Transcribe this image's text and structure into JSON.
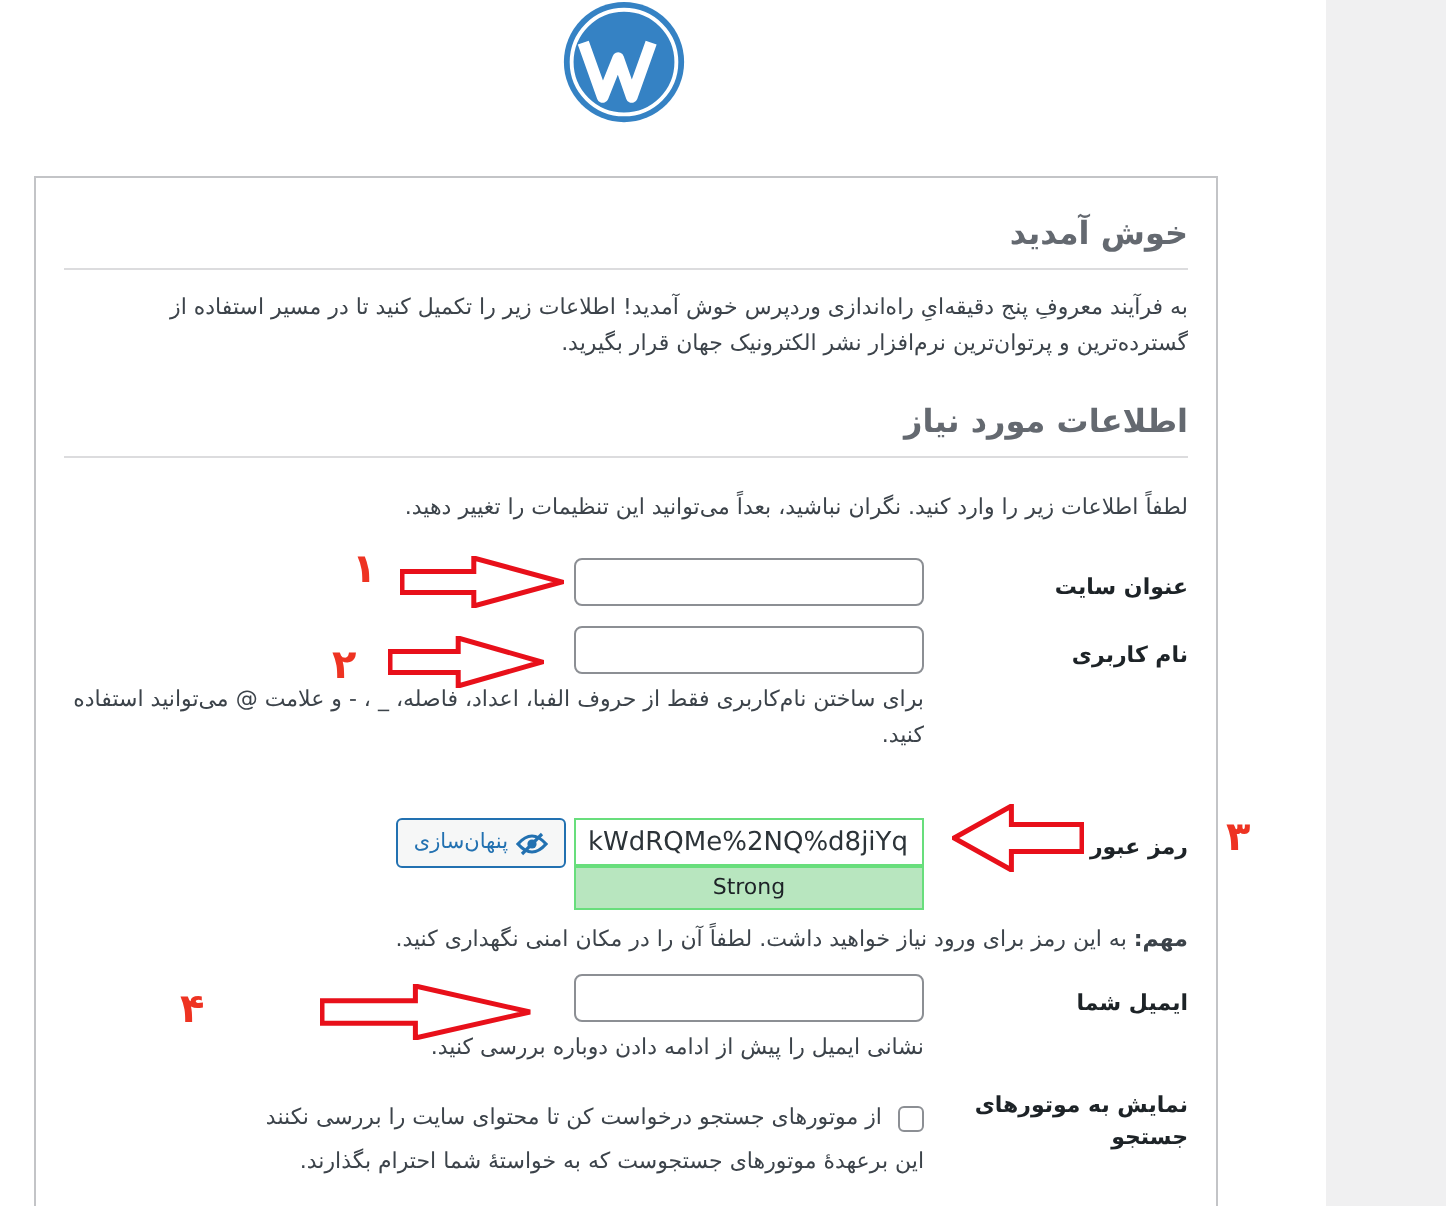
{
  "welcome": {
    "title": "خوش آمدید",
    "text": "به فرآیند معروفِ پنج دقیقه‌ایِ راه‌اندازی وردپرس خوش آمدید! اطلاعات زیر را تکمیل کنید تا در مسیر استفاده از گسترده‌ترین و پرتوان‌ترین نرم‌افزار نشر الکترونیک جهان قرار بگیرید."
  },
  "required": {
    "title": "اطلاعات مورد نیاز",
    "intro": "لطفاً اطلاعات زیر را وارد کنید. نگران نباشید، بعداً می‌توانید این تنظیمات را تغییر دهید."
  },
  "fields": [
    {
      "kind": "text",
      "label": "عنوان سایت"
    },
    {
      "kind": "text",
      "label": "نام کاربری",
      "help": "برای ساختن نام‌کاربری فقط از حروف الفبا، اعداد، فاصله، _ ، - و علامت @ می‌توانید استفاده کنید."
    },
    {
      "kind": "password",
      "label": "رمز عبور",
      "value": "kWdRQMe%2NQ%d8jiYq",
      "strength": "Strong",
      "toggle": "پنهان‌سازی",
      "help": "**مهم:** به این رمز برای ورود نیاز خواهید داشت. لطفاً آن را در مکان امنی نگهداری کنید."
    },
    {
      "kind": "text",
      "label": "ایمیل شما",
      "help": "نشانی ایمیل را پیش از ادامه دادن دوباره بررسی کنید."
    },
    {
      "kind": "checkbox",
      "label": "نمایش به موتورهای جستجو",
      "option": "از موتورهای جستجو درخواست کن تا محتوای سایت را بررسی نکنند",
      "checked": false,
      "help": "این برعهدهٔ موتورهای جستجوست که به خواستهٔ شما احترام بگذارند."
    }
  ],
  "annotations": [
    {
      "number": "۱"
    },
    {
      "number": "۲"
    },
    {
      "number": "۳"
    },
    {
      "number": "۴"
    }
  ]
}
